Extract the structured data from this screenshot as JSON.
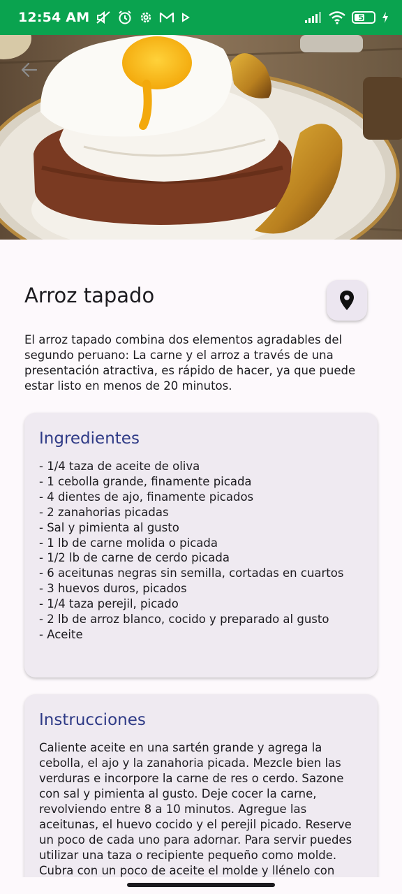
{
  "status_bar": {
    "time": "12:54 AM",
    "battery_level": "55",
    "battery_fraction": 0.55,
    "background_color": "#0aa34f",
    "left_icons": [
      "mute-icon",
      "alarm-icon",
      "settings-icon",
      "gmail-icon",
      "play-icon"
    ],
    "right_icons": [
      "signal-icon",
      "wifi-icon",
      "battery-icon",
      "charging-icon"
    ]
  },
  "hero": {
    "image_description_icon": "food-photo",
    "back_icon": "arrow-left-icon"
  },
  "recipe": {
    "title": "Arroz tapado",
    "location_icon": "map-pin-icon",
    "description": "El arroz tapado combina dos elementos agradables del segundo peruano: La carne y el arroz a través de una presentación atractiva, es rápido de hacer, ya que puede estar listo en menos de 20 minutos."
  },
  "ingredients": {
    "title": "Ingredientes",
    "items": [
      "- 1/4 taza de aceite de oliva",
      "- 1 cebolla grande, finamente picada",
      "- 4 dientes de ajo, finamente picados",
      "- 2 zanahorias picadas",
      "- Sal y pimienta al gusto",
      "- 1 lb de carne molida o picada",
      "- 1/2 lb de carne de cerdo picada",
      "- 6 aceitunas negras sin semilla, cortadas en cuartos",
      "- 3 huevos duros, picados",
      "- 1/4 taza perejil, picado",
      "- 2 lb de arroz blanco, cocido y preparado al gusto",
      "- Aceite"
    ]
  },
  "instructions": {
    "title": "Instrucciones",
    "text": "Caliente aceite en una sartén grande y agrega la cebolla, el ajo y la zanahoria picada. Mezcle bien las verduras e incorpore la carne de res o cerdo. Sazone con sal y pimienta al gusto. Deje cocer la carne, revolviendo entre 8 a 10 minutos. Agregue las aceitunas, el huevo cocido y el perejil picado. Reserve un poco de cada uno para adornar. Para servir puedes utilizar una taza o recipiente pequeño como molde. Cubra con un poco de aceite el molde y llénelo con arroz hasta la mitad. Coloca entre"
  },
  "colors": {
    "accent_title": "#2e3a86",
    "card_background": "#efeaf1",
    "page_background": "#fdf9fc"
  }
}
